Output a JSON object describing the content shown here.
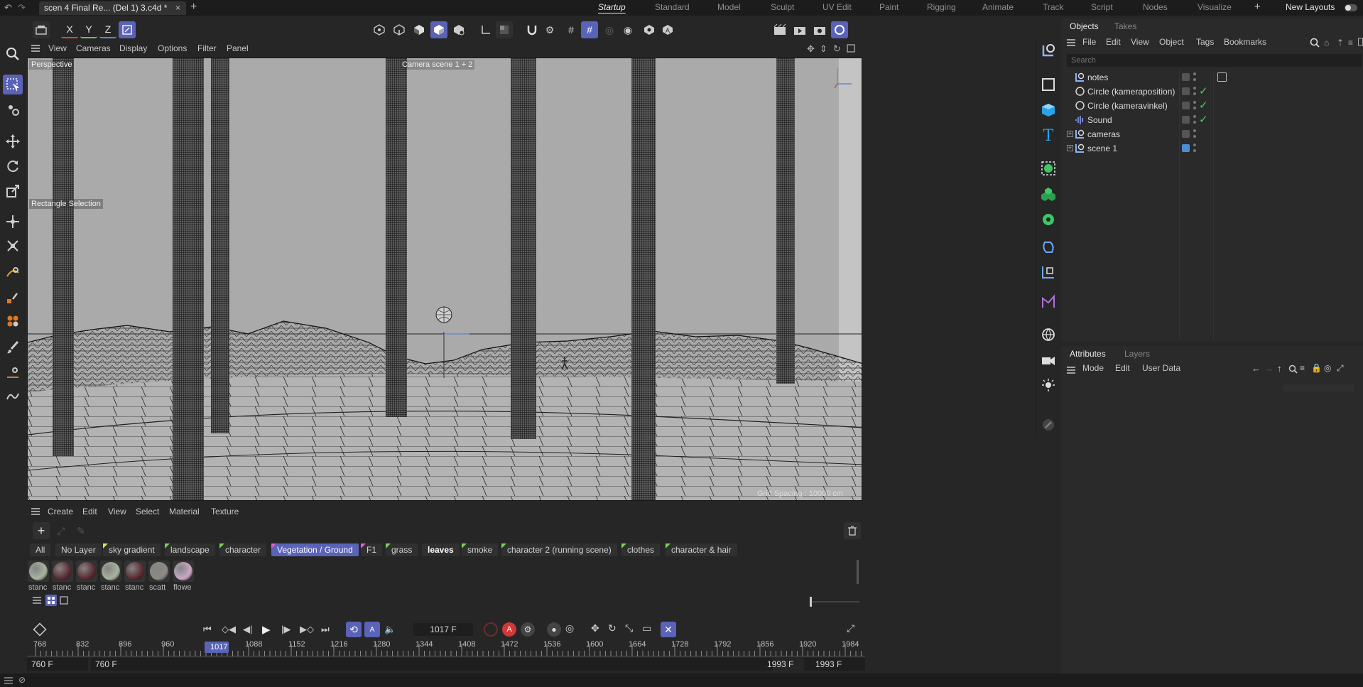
{
  "titlebar": {
    "document_tab": "scen 4 Final Re... (Del 1) 3.c4d *",
    "close_glyph": "×",
    "new_tab_glyph": "+",
    "layouts": [
      "Startup",
      "Standard",
      "Model",
      "Sculpt",
      "UV Edit",
      "Paint",
      "Rigging",
      "Animate",
      "Track",
      "Script",
      "Nodes",
      "Visualize"
    ],
    "active_layout": "Startup",
    "add_layout_glyph": "+",
    "new_layouts": "New Layouts"
  },
  "axis_lock": {
    "x": "X",
    "y": "Y",
    "z": "Z"
  },
  "viewport": {
    "menu": [
      "View",
      "Cameras",
      "Display",
      "Options",
      "Filter",
      "Panel"
    ],
    "projection_label": "Perspective",
    "camera_label": "Camera scene 1 + 2",
    "tool_label": "Rectangle Selection",
    "grid_info": "Grid Spacing : 10000 cm"
  },
  "materials": {
    "menu": [
      "Create",
      "Edit",
      "View",
      "Select",
      "Material",
      "Texture"
    ],
    "layers": [
      {
        "label": "All",
        "active": false
      },
      {
        "label": "No Layer",
        "active": false
      },
      {
        "label": "sky gradient",
        "active": false
      },
      {
        "label": "landscape",
        "active": false
      },
      {
        "label": "character",
        "active": false
      },
      {
        "label": "Vegetation / Ground",
        "active": true
      },
      {
        "label": "F1",
        "active": false
      },
      {
        "label": "grass",
        "active": false
      },
      {
        "label": "leaves",
        "active": false
      },
      {
        "label": "smoke",
        "active": false
      },
      {
        "label": "character 2 (running scene)",
        "active": false
      },
      {
        "label": "clothes",
        "active": false
      },
      {
        "label": "character & hair",
        "active": false
      }
    ],
    "swatches": [
      {
        "name": "stanc",
        "color": "#a7b49e"
      },
      {
        "name": "stanc",
        "color": "#5a2a31"
      },
      {
        "name": "stanc",
        "color": "#5a2a31"
      },
      {
        "name": "stanc",
        "color": "#a7b49e"
      },
      {
        "name": "stanc",
        "color": "#5a2a31"
      },
      {
        "name": "scatt",
        "color": "#8d8a82"
      },
      {
        "name": "flowe",
        "color": "#c9a8c6"
      }
    ]
  },
  "timeline": {
    "current_frame": "1017 F",
    "playhead_label": "1017",
    "ruler": [
      "768",
      "832",
      "896",
      "960",
      "1088",
      "1152",
      "1216",
      "1280",
      "1344",
      "1408",
      "1472",
      "1536",
      "1600",
      "1664",
      "1728",
      "1792",
      "1856",
      "1920",
      "1984"
    ],
    "start_min": "760 F",
    "start": "760 F",
    "end": "1993 F",
    "end_max": "1993 F"
  },
  "objects_panel": {
    "tabs": [
      "Objects",
      "Takes"
    ],
    "menu": [
      "File",
      "Edit",
      "View",
      "Object",
      "Tags",
      "Bookmarks"
    ],
    "search_placeholder": "Search",
    "items": [
      {
        "name": "notes",
        "icon": "null-object-icon",
        "checked": false
      },
      {
        "name": "Circle (kameraposition)",
        "icon": "circle-spline-icon",
        "checked": true
      },
      {
        "name": "Circle (kameravinkel)",
        "icon": "circle-spline-icon",
        "checked": true
      },
      {
        "name": "Sound",
        "icon": "sound-icon",
        "checked": true
      },
      {
        "name": "cameras",
        "icon": "null-object-icon",
        "checked": false
      },
      {
        "name": "scene 1",
        "icon": "null-object-icon",
        "checked": false
      }
    ]
  },
  "attributes_panel": {
    "tabs": [
      "Attributes",
      "Layers"
    ],
    "menu": [
      "Mode",
      "Edit",
      "User Data"
    ]
  },
  "colors": {
    "accent": "#5a63b8",
    "check": "#3ed25a",
    "bg": "#262626",
    "viewport": "#a9a9a9"
  }
}
